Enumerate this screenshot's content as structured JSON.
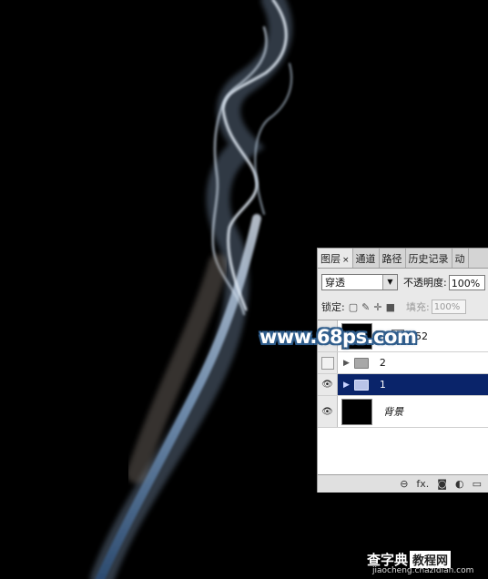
{
  "panel": {
    "tabs": [
      {
        "label": "图层",
        "close": "×"
      },
      {
        "label": "通道"
      },
      {
        "label": "路径"
      },
      {
        "label": "历史记录"
      },
      {
        "label": "动"
      }
    ],
    "blend_mode": "穿透",
    "opacity_label": "不透明度:",
    "opacity_value": "100%",
    "lock_label": "锁定:",
    "fill_label": "填充:",
    "fill_value": "100%",
    "layers": [
      {
        "name": "52",
        "type": "adjustment",
        "visible": true
      },
      {
        "name": "2",
        "type": "group",
        "visible": false
      },
      {
        "name": "1",
        "type": "group",
        "visible": true,
        "selected": true
      },
      {
        "name": "背景",
        "type": "background",
        "visible": true
      }
    ],
    "bottom_icons": [
      "link-icon",
      "fx-icon",
      "mask-icon",
      "adjustment-icon",
      "new-group-icon"
    ],
    "fx_label": "fx."
  },
  "watermark": {
    "site": "www.68ps.com",
    "corner_title": "查字典",
    "corner_box": "教程网",
    "corner_url": "jiaocheng.chazidian.com"
  },
  "colors": {
    "smoke_light": "#dfe8f2",
    "smoke_blue": "#6d8fb5",
    "selection": "#0a246a"
  }
}
